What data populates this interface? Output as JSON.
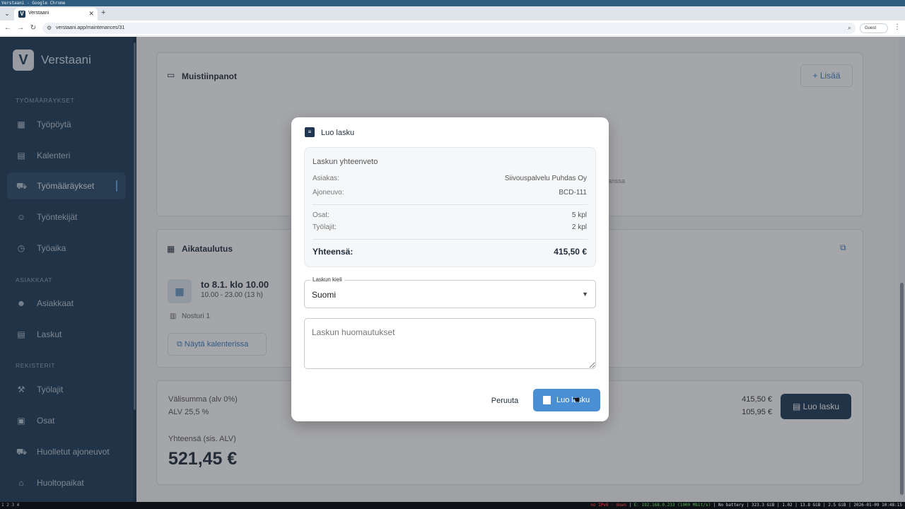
{
  "os": {
    "window_title": "Verstaani - Google Chrome"
  },
  "browser": {
    "tab_title": "Verstaani",
    "url": "verstaani.app/maintenances/31",
    "profile_label": "Guest"
  },
  "sidebar": {
    "brand": "Verstaani",
    "sections": [
      {
        "title": "TYÖMÄÄRÄYKSET"
      },
      {
        "title": "ASIAKKAAT"
      },
      {
        "title": "REKISTERIT"
      }
    ],
    "items": [
      {
        "label": "Työpöytä",
        "icon": "dashboard-icon"
      },
      {
        "label": "Kalenteri",
        "icon": "calendar-icon"
      },
      {
        "label": "Työmääräykset",
        "icon": "car-icon",
        "active": true
      },
      {
        "label": "Työntekijät",
        "icon": "people-icon"
      },
      {
        "label": "Työaika",
        "icon": "clock-icon"
      },
      {
        "label": "Asiakkaat",
        "icon": "group-icon"
      },
      {
        "label": "Laskut",
        "icon": "receipt-icon"
      },
      {
        "label": "Työlajit",
        "icon": "wrench-icon"
      },
      {
        "label": "Osat",
        "icon": "archive-icon"
      },
      {
        "label": "Huolletut ajoneuvot",
        "icon": "car-icon"
      },
      {
        "label": "Huoltopaikat",
        "icon": "garage-icon"
      }
    ]
  },
  "main": {
    "notes": {
      "title": "Muistiinpanot",
      "add_label": "Lisää",
      "faded_text": "anssa"
    },
    "schedule": {
      "title": "Aikataulutus",
      "date": "to 8.1. klo 10.00",
      "time": "10.00 - 23.00 (13 h)",
      "resource": "Nosturi 1",
      "calendar_button": "Näytä kalenterissa"
    },
    "totals": {
      "subtotal_label": "Välisumma (alv 0%)",
      "subtotal_value": "415,50 €",
      "vat_label": "ALV 25,5 %",
      "vat_value": "105,95 €",
      "total_label": "Yhteensä (sis. ALV)",
      "total_value": "521,45 €",
      "invoice_button": "Luo lasku"
    }
  },
  "modal": {
    "title": "Luo lasku",
    "summary": {
      "heading": "Laskun yhteenveto",
      "customer_label": "Asiakas:",
      "customer_value": "Siivouspalvelu Puhdas Oy",
      "vehicle_label": "Ajoneuvo:",
      "vehicle_value": "BCD-111",
      "parts_label": "Osat:",
      "parts_value": "5 kpl",
      "worktypes_label": "Työlajit:",
      "worktypes_value": "2 kpl",
      "total_label": "Yhteensä:",
      "total_value": "415,50 €"
    },
    "language": {
      "label": "Laskun kieli",
      "value": "Suomi"
    },
    "notes_placeholder": "Laskun huomautukset",
    "cancel_label": "Peruuta",
    "create_label": "Luo lasku"
  },
  "status_bar": {
    "left": "1 2 3 4",
    "warn": "no IPv6 · down",
    "net": "E: 192.168.0.233 (1000 Mbit/s)",
    "right": "No battery | 323.3 GiB | 1.02 | 13.8 GiB | 2.5 GiB | 2026-01-09 10:48:15"
  }
}
